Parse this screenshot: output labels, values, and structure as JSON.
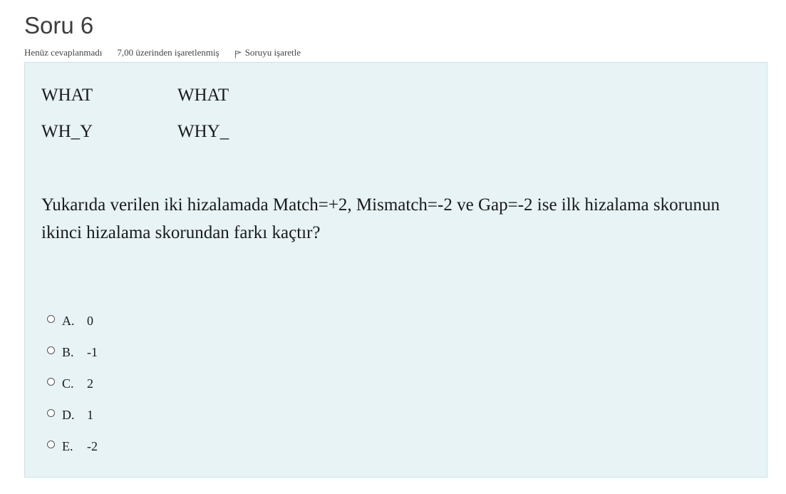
{
  "question": {
    "title": "Soru 6",
    "state": "Henüz cevaplanmadı",
    "grade": "7,00 üzerinden işaretlenmiş",
    "flag_label": "Soruyu işaretle"
  },
  "alignments": {
    "row1": [
      "WHAT",
      "WHAT"
    ],
    "row2": [
      "WH_Y",
      "WHY_"
    ]
  },
  "question_text": "Yukarıda verilen iki hizalamada Match=+2, Mismatch=-2 ve Gap=-2 ise ilk hizalama skorunun ikinci hizalama skorundan farkı kaçtır?",
  "answers": [
    {
      "letter": "A.",
      "value": "0",
      "selected": false
    },
    {
      "letter": "B.",
      "value": "-1",
      "selected": false
    },
    {
      "letter": "C.",
      "value": "2",
      "selected": false
    },
    {
      "letter": "D.",
      "value": "1",
      "selected": false
    },
    {
      "letter": "E.",
      "value": "-2",
      "selected": false
    }
  ],
  "colors": {
    "box_bg": "#e7f3f5",
    "box_border": "#c7e3ea",
    "title": "#3d3d3d",
    "text": "#1a1a1a"
  },
  "icons": {
    "flag": "flag-icon",
    "radio": "radio-icon"
  }
}
